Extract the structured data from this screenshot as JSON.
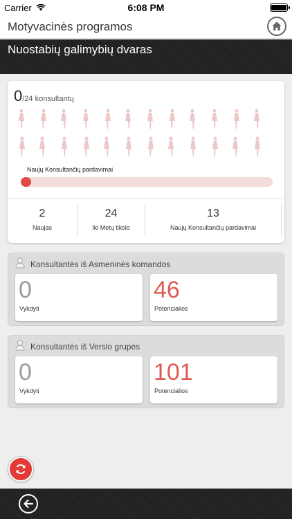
{
  "status_bar": {
    "carrier": "Carrier",
    "time": "6:08 PM"
  },
  "nav": {
    "title": "Motyvacinės programos"
  },
  "banner": {
    "title": "Nuostabių galimybių dvaras"
  },
  "summary": {
    "current": "0",
    "of_text": "/24 konsultantų",
    "figures_total": 24,
    "sales_label": "Naujų Konsultančių pardavimai",
    "progress_fraction": 0.04,
    "stats": [
      {
        "value": "2",
        "label": "Naujas"
      },
      {
        "value": "24",
        "label": "Iki Metų tikslo"
      },
      {
        "value": "13",
        "label": "Naujų Konsultančių pardavimai"
      }
    ]
  },
  "personal_team": {
    "title": "Konsultantės iš Asmeninės komandos",
    "left": {
      "value": "0",
      "label": "Vykdyti"
    },
    "right": {
      "value": "46",
      "label": "Potencialios"
    }
  },
  "business_group": {
    "title": "Konsultantės iš Verslo grupės",
    "left": {
      "value": "0",
      "label": "Vykdyti"
    },
    "right": {
      "value": "101",
      "label": "Potencialios"
    }
  },
  "icons": {
    "home": "home-icon",
    "refresh": "refresh-icon",
    "back": "back-arrow-icon",
    "person": "person-icon"
  },
  "colors": {
    "accent_red": "#e24b43",
    "number_red": "#e05a55",
    "bar_track": "#f3dcdc",
    "figure_pink": "#ecc8c8"
  }
}
